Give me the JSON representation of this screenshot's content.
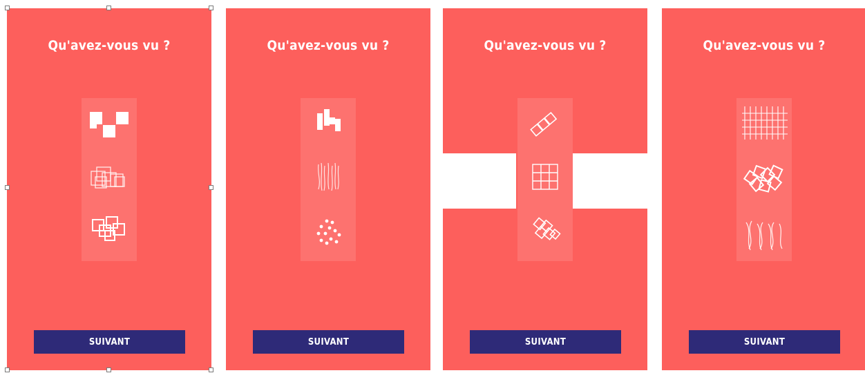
{
  "panels": [
    {
      "title": "Qu'avez-vous vu ?",
      "button": "SUIVANT"
    },
    {
      "title": "Qu'avez-vous vu ?",
      "button": "SUIVANT"
    },
    {
      "title": "Qu'avez-vous vu ?",
      "button": "SUIVANT"
    },
    {
      "title": "Qu'avez-vous vu ?",
      "button": "SUIVANT"
    }
  ],
  "colors": {
    "background": "#fd5f5c",
    "button": "#2e2a78",
    "text": "#ffffff"
  },
  "icons": [
    [
      "checker-blocks-icon",
      "overlapping-squares-icon",
      "scattered-squares-icon"
    ],
    [
      "vertical-bars-icon",
      "wavy-lines-icon",
      "dots-icon"
    ],
    [
      "diagonal-tiles-icon",
      "grid-icon",
      "rotated-squares-icon"
    ],
    [
      "crosshatch-grid-icon",
      "tilted-squares-cluster-icon",
      "curved-lines-icon"
    ]
  ]
}
